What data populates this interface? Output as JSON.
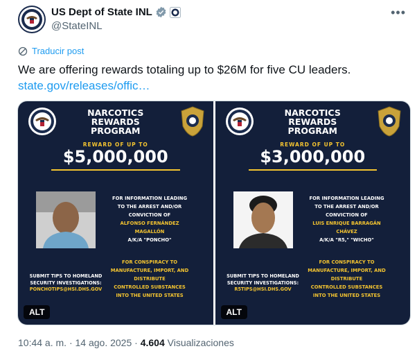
{
  "tweet": {
    "author_name": "US Dept of State INL",
    "handle": "@StateINL",
    "translate_label": "Traducir post",
    "text": "We are offering rewards totaling up to $26M for five CU leaders.",
    "link": "state.gov/releases/offic…",
    "time": "10:44 a. m.",
    "date": "14 ago. 2025",
    "views_count": "4.604",
    "views_label": "Visualizaciones",
    "icons": [
      "verified-badge-icon",
      "affiliate-seal-icon",
      "more-icon",
      "translate-icon"
    ]
  },
  "posters": [
    {
      "title_line1": "NARCOTICS",
      "title_line2": "REWARDS",
      "title_line3": "PROGRAM",
      "reward_label": "REWARD OF UP TO",
      "amount": "$5,000,000",
      "info_line1": "FOR INFORMATION LEADING",
      "info_line2": "TO THE ARREST AND/OR",
      "info_line3": "CONVICTION OF",
      "name_line1": "ALFONSO FERNÁNDEZ",
      "name_line2": "MAGALLÓN",
      "aka": "A/K/A \"PONCHO\"",
      "charge_line1": "FOR CONSPIRACY TO",
      "charge_line2": "MANUFACTURE, IMPORT, AND",
      "charge_line3": "DISTRIBUTE",
      "charge_line4": "CONTROLLED SUBSTANCES",
      "charge_line5": "INTO THE UNITED STATES",
      "tips_line1": "SUBMIT TIPS TO HOMELAND",
      "tips_line2": "SECURITY INVESTIGATIONS:",
      "tips_email": "PONCHOTIPS@HSI.DHS.GOV",
      "alt_label": "ALT"
    },
    {
      "title_line1": "NARCOTICS",
      "title_line2": "REWARDS",
      "title_line3": "PROGRAM",
      "reward_label": "REWARD OF UP TO",
      "amount": "$3,000,000",
      "info_line1": "FOR INFORMATION LEADING",
      "info_line2": "TO THE ARREST AND/OR",
      "info_line3": "CONVICTION OF",
      "name_line1": "LUIS ENRIQUE BARRAGÁN",
      "name_line2": "CHÁVEZ",
      "aka": "A/K/A \"R5,\" \"WICHO\"",
      "charge_line1": "FOR CONSPIRACY TO",
      "charge_line2": "MANUFACTURE, IMPORT, AND",
      "charge_line3": "DISTRIBUTE",
      "charge_line4": "CONTROLLED SUBSTANCES",
      "charge_line5": "INTO THE UNITED STATES",
      "tips_line1": "SUBMIT TIPS TO HOMELAND",
      "tips_line2": "SECURITY INVESTIGATIONS:",
      "tips_email": "R5TIPS@HSI.DHS.GOV",
      "alt_label": "ALT"
    }
  ],
  "colors": {
    "poster_bg": "#131f3a",
    "accent_gold": "#f4c430",
    "link_blue": "#1d9bf0",
    "muted_text": "#536471"
  }
}
